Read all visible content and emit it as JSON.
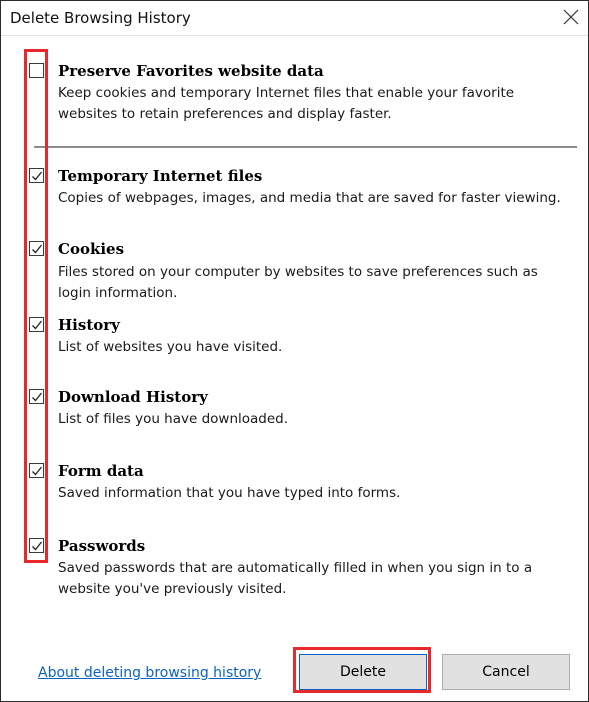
{
  "window": {
    "title": "Delete Browsing History"
  },
  "options": [
    {
      "title": "Preserve Favorites website data",
      "description": "Keep cookies and temporary Internet files that enable your favorite websites to retain preferences and display faster.",
      "checked": false
    },
    {
      "title": "Temporary Internet files",
      "description": "Copies of webpages, images, and media that are saved for faster viewing.",
      "checked": true
    },
    {
      "title": "Cookies",
      "description": "Files stored on your computer by websites to save preferences such as login information.",
      "checked": true
    },
    {
      "title": "History",
      "description": "List of websites you have visited.",
      "checked": true
    },
    {
      "title": "Download History",
      "description": "List of files you have downloaded.",
      "checked": true
    },
    {
      "title": "Form data",
      "description": "Saved information that you have typed into forms.",
      "checked": true
    },
    {
      "title": "Passwords",
      "description": "Saved passwords that are automatically filled in when you sign in to a website you've previously visited.",
      "checked": true
    }
  ],
  "footer": {
    "link_label": "About deleting browsing history",
    "delete_label": "Delete",
    "cancel_label": "Cancel"
  },
  "colors": {
    "highlight": "#e8282d",
    "link": "#0b62c4",
    "button_face": "#e1e1e1",
    "default_button_border": "#0a64c7"
  },
  "icons": {
    "close": "close-icon",
    "checkmark": "checkmark-icon"
  }
}
